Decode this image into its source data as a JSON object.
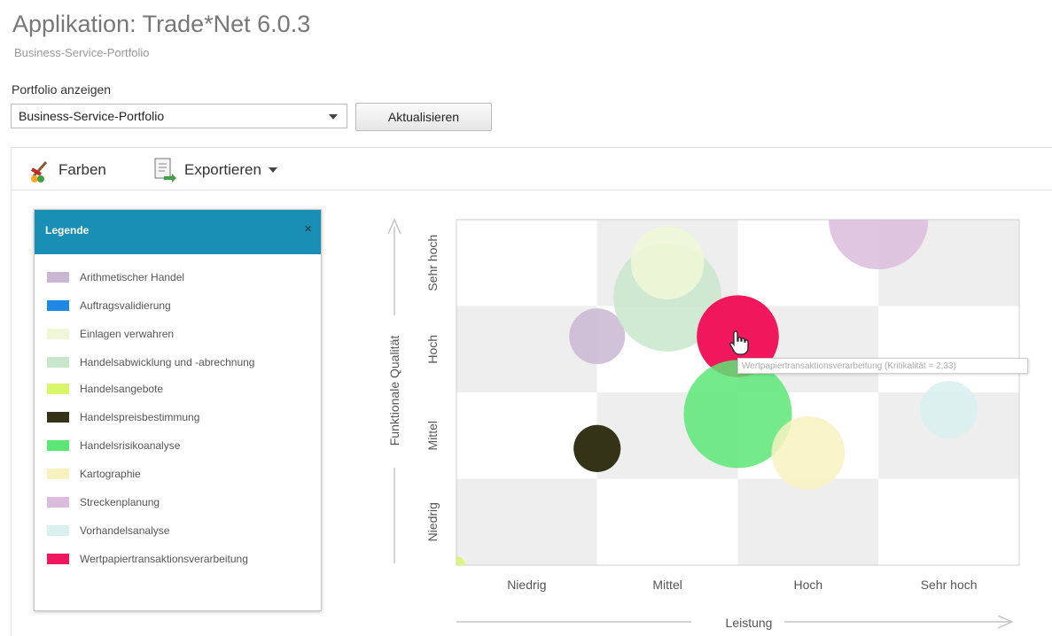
{
  "header": {
    "title": "Applikation: Trade*Net 6.0.3",
    "subtitle": "Business-Service-Portfolio"
  },
  "portfolio": {
    "label": "Portfolio anzeigen",
    "selected": "Business-Service-Portfolio",
    "refresh_label": "Aktualisieren"
  },
  "toolbar": {
    "colors_label": "Farben",
    "export_label": "Exportieren",
    "colors_icon": "paint-brush-icon",
    "export_icon": "export-document-icon"
  },
  "legend": {
    "title": "Legende",
    "close_glyph": "×",
    "items": [
      {
        "label": "Arithmetischer Handel",
        "color": "#c9b6d2"
      },
      {
        "label": "Auftragsvalidierung",
        "color": "#1e88e5"
      },
      {
        "label": "Einlagen verwahren",
        "color": "#eef8d6"
      },
      {
        "label": "Handelsabwicklung und -abrechnung",
        "color": "#c8e6cc"
      },
      {
        "label": "Handelsangebote",
        "color": "#d9f56a"
      },
      {
        "label": "Handelspreisbestimmung",
        "color": "#343318"
      },
      {
        "label": "Handelsrisikoanalyse",
        "color": "#5ce676"
      },
      {
        "label": "Kartographie",
        "color": "#f8f2c0"
      },
      {
        "label": "Streckenplanung",
        "color": "#dcbcdc"
      },
      {
        "label": "Vorhandelsanalyse",
        "color": "#d8f0ee"
      },
      {
        "label": "Wertpapiertransaktionsverarbeitung",
        "color": "#f0175d"
      }
    ]
  },
  "chart_data": {
    "type": "scatter",
    "xlabel": "Leistung",
    "ylabel": "Funktionale Qualität",
    "x_categories": [
      "Niedrig",
      "Mittel",
      "Hoch",
      "Sehr hoch"
    ],
    "y_categories": [
      "Niedrig",
      "Mittel",
      "Hoch",
      "Sehr hoch"
    ],
    "xlim": [
      0,
      4
    ],
    "ylim": [
      0,
      4
    ],
    "grid": "checkerboard",
    "points": [
      {
        "name": "Arithmetischer Handel",
        "x": 1.0,
        "y": 2.65,
        "size": 0.32
      },
      {
        "name": "Handelsabwicklung und -abrechnung",
        "x": 1.5,
        "y": 3.1,
        "size": 0.62
      },
      {
        "name": "Einlagen verwahren",
        "x": 1.5,
        "y": 3.5,
        "size": 0.42
      },
      {
        "name": "Streckenplanung",
        "x": 3.0,
        "y": 4.0,
        "size": 0.57
      },
      {
        "name": "Wertpapiertransaktionsverarbeitung",
        "x": 2.0,
        "y": 2.65,
        "size": 0.47
      },
      {
        "name": "Handelsrisikoanalyse",
        "x": 2.0,
        "y": 1.75,
        "size": 0.62
      },
      {
        "name": "Kartographie",
        "x": 2.5,
        "y": 1.3,
        "size": 0.42
      },
      {
        "name": "Vorhandelsanalyse",
        "x": 3.5,
        "y": 1.8,
        "size": 0.33
      },
      {
        "name": "Handelspreisbestimmung",
        "x": 1.0,
        "y": 1.35,
        "size": 0.27
      },
      {
        "name": "Handelsangebote",
        "x": 0.0,
        "y": 0.0,
        "size": 0.1
      }
    ]
  },
  "tooltip": {
    "text": "Wertpapiertransaktionsverarbeitung (Kritikalität = 2,33)"
  }
}
